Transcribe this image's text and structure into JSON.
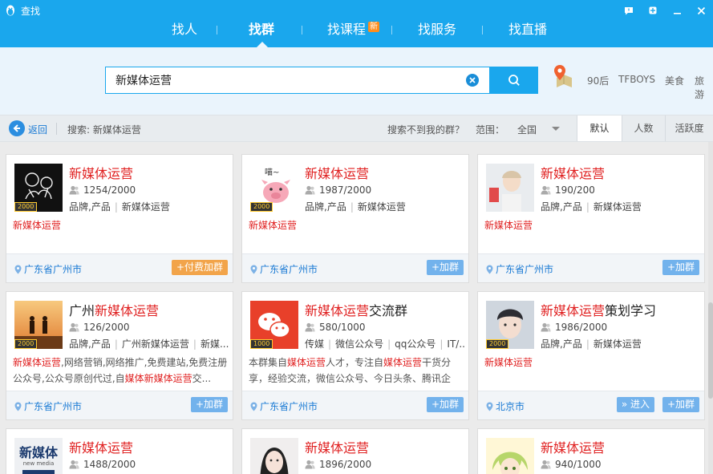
{
  "window": {
    "title": "查找",
    "controls": [
      "feedback-icon",
      "skin-icon",
      "minimize-icon",
      "close-icon"
    ]
  },
  "nav": {
    "tabs": [
      {
        "label": "找人",
        "active": false
      },
      {
        "label": "找群",
        "active": true
      },
      {
        "label": "找课程",
        "badge": "新",
        "active": false
      },
      {
        "label": "找服务",
        "active": false
      },
      {
        "label": "找直播",
        "active": false
      }
    ]
  },
  "search": {
    "value": "新媒体运营",
    "hot_tags": [
      "90后",
      "TFBOYS",
      "美食",
      "旅游"
    ]
  },
  "filter": {
    "back_label": "返回",
    "query_label": "搜索: 新媒体运营",
    "no_result_label": "搜索不到我的群？",
    "scope_label": "范围：",
    "scope_value": "全国",
    "sort_tabs": [
      {
        "label": "默认",
        "active": true
      },
      {
        "label": "人数",
        "active": false
      },
      {
        "label": "活跃度",
        "active": false
      }
    ]
  },
  "cards": [
    {
      "name_pre": "",
      "name_hl": "新媒体运营",
      "name_post": "",
      "members": "1254/2000",
      "tags": [
        "品牌,产品",
        "新媒体运营"
      ],
      "desc": [
        {
          "t": "新媒体运营",
          "h": true
        }
      ],
      "location": "广东省广州市",
      "join": "+付费加群",
      "paid": true,
      "level": "2000",
      "avatar": "dark"
    },
    {
      "name_pre": "",
      "name_hl": "新媒体运营",
      "name_post": "",
      "members": "1987/2000",
      "tags": [
        "品牌,产品",
        "新媒体运营"
      ],
      "desc": [
        {
          "t": "新媒体运营",
          "h": true
        }
      ],
      "location": "广东省广州市",
      "join": "+加群",
      "paid": false,
      "level": "2000",
      "avatar": "pig"
    },
    {
      "name_pre": "",
      "name_hl": "新媒体运营",
      "name_post": "",
      "members": "190/200",
      "tags": [
        "品牌,产品",
        "新媒体运营"
      ],
      "desc": [
        {
          "t": "新媒体运营",
          "h": true
        }
      ],
      "location": "广东省广州市",
      "join": "+加群",
      "paid": false,
      "level": "",
      "avatar": "girl"
    },
    {
      "name_pre": "广州",
      "name_hl": "新媒体运营",
      "name_post": "",
      "members": "126/2000",
      "tags": [
        "品牌,产品",
        "广州新媒体运营",
        "新媒..."
      ],
      "desc": [
        {
          "t": "新媒体运营",
          "h": true
        },
        {
          "t": ",网络营销,网络推广,免费建站,免费注册公众号,公众号原创代过,自",
          "h": false
        },
        {
          "t": "媒体新媒体运营",
          "h": true
        },
        {
          "t": "交...",
          "h": false
        }
      ],
      "location": "广东省广州市",
      "join": "+加群",
      "paid": false,
      "level": "2000",
      "avatar": "sunset"
    },
    {
      "name_pre": "",
      "name_hl": "新媒体运营",
      "name_post": "交流群",
      "members": "580/1000",
      "tags": [
        "传媒",
        "微信公众号",
        "qq公众号",
        "IT/..."
      ],
      "desc": [
        {
          "t": "本群集自",
          "h": false
        },
        {
          "t": "媒体运营",
          "h": true
        },
        {
          "t": "人才，专注自",
          "h": false
        },
        {
          "t": "媒体运营",
          "h": true
        },
        {
          "t": "干货分享，经验交流，微信公众号、今日头条、腾讯企鹅...",
          "h": false
        }
      ],
      "location": "广东省广州市",
      "join": "+加群",
      "paid": false,
      "level": "1000",
      "avatar": "wechat"
    },
    {
      "name_pre": "",
      "name_hl": "新媒体运营",
      "name_post": "策划学习",
      "members": "1986/2000",
      "tags": [
        "品牌,产品",
        "新媒体运营"
      ],
      "desc": [
        {
          "t": "新媒体运营",
          "h": true
        }
      ],
      "location": "北京市",
      "join": "+加群",
      "enter": "» 进入",
      "paid": false,
      "level": "2000",
      "avatar": "boy"
    },
    {
      "name_pre": "",
      "name_hl": "新媒体运营",
      "name_post": "",
      "members": "1488/2000",
      "tags": [],
      "desc": [],
      "location": "",
      "join": "",
      "paid": false,
      "level": "",
      "avatar": "text",
      "avatar_text": "新媒体",
      "avatar_sub": "new media"
    },
    {
      "name_pre": "",
      "name_hl": "新媒体运营",
      "name_post": "",
      "members": "1896/2000",
      "tags": [],
      "desc": [],
      "location": "",
      "join": "",
      "paid": false,
      "level": "",
      "avatar": "woman"
    },
    {
      "name_pre": "",
      "name_hl": "新媒体运营",
      "name_post": "",
      "members": "940/1000",
      "tags": [],
      "desc": [],
      "location": "",
      "join": "",
      "paid": false,
      "level": "",
      "avatar": "anime"
    }
  ]
}
